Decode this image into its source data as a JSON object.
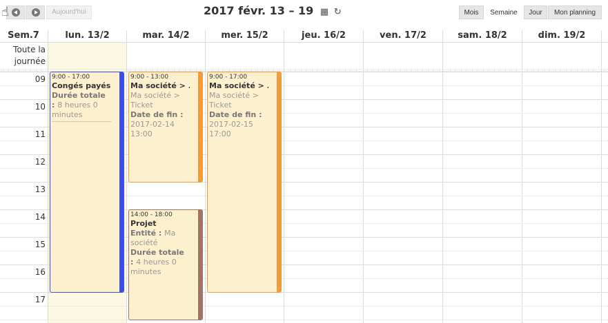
{
  "toolbar": {
    "today_label": "Aujourd'hui",
    "title_main": "2017 févr. 13 – 19",
    "views": [
      "Mois",
      "Semaine",
      "Jour",
      "Mon planning"
    ],
    "active_view": "Semaine"
  },
  "grid": {
    "week_label": "Sem.7",
    "days": [
      "lun. 13/2",
      "mar. 14/2",
      "mer. 15/2",
      "jeu. 16/2",
      "ven. 17/2",
      "sam. 18/2",
      "dim. 19/2"
    ],
    "all_day_line1": "Toute la",
    "all_day_line2": "journée",
    "hours": [
      "09",
      "10",
      "11",
      "12",
      "13",
      "14",
      "15",
      "16",
      "17"
    ]
  },
  "events": {
    "conges": {
      "time": "9:00 - 17:00",
      "title": "Congés payés",
      "duration_label": "Durée totale",
      "duration_value": "8 heures 0 minutes",
      "stripe_color": "#3b4fe8"
    },
    "ticket_tue": {
      "time": "9:00 - 13:00",
      "title": "Ma société > ...",
      "subtitle": "Ma société > Ticket",
      "end_label": "Date de fin",
      "end_value": "2017-02-14 13:00",
      "stripe_color": "#f39a3b"
    },
    "ticket_wed": {
      "time": "9:00 - 17:00",
      "title": "Ma société > ...",
      "subtitle": "Ma société > Ticket",
      "end_label": "Date de fin",
      "end_value": "2017-02-15 17:00",
      "stripe_color": "#f39a3b"
    },
    "projet": {
      "time": "14:00 - 18:00",
      "title": "Projet",
      "entity_label": "Entité",
      "entity_value": "Ma société",
      "duration_label": "Durée totale",
      "duration_value": "4 heures 0 minutes",
      "stripe_color": "#9f7367"
    }
  }
}
